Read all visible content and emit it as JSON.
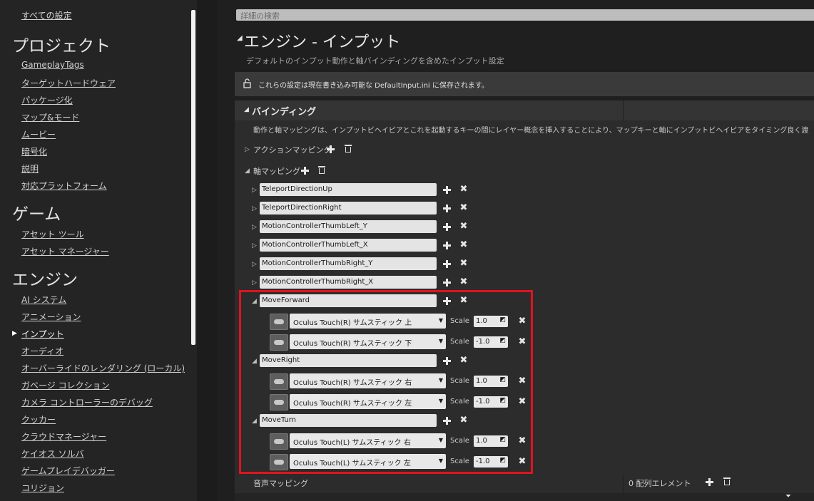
{
  "sidebar": {
    "all_settings": "すべての設定",
    "categories": [
      {
        "title": "プロジェクト",
        "items": [
          "GameplayTags",
          "ターゲットハードウェア",
          "パッケージ化",
          "マップ&モード",
          "ムービー",
          "暗号化",
          "説明",
          "対応プラットフォーム"
        ]
      },
      {
        "title": "ゲーム",
        "items": [
          "アセット ツール",
          "アセット マネージャー"
        ]
      },
      {
        "title": "エンジン",
        "items": [
          "AI システム",
          "アニメーション",
          "インプット",
          "オーディオ",
          "オーバーライドのレンダリング (ローカル)",
          "ガベージ コレクション",
          "カメラ コントローラーのデバッグ",
          "クッカー",
          "クラウドマネージャー",
          "ケイオス ソルバ",
          "ゲームプレイデバッガー",
          "コリジョン"
        ]
      }
    ],
    "active_item": "インプット"
  },
  "search": {
    "placeholder": "詳細の検索"
  },
  "header": {
    "title": "エンジン - インプット",
    "description": "デフォルトのインプット動作と軸バインディングを含めたインプット設定"
  },
  "notice": {
    "text": "これらの設定は現在書き込み可能な DefaultInput.ini に保存されます。"
  },
  "bindings": {
    "title": "バインディング",
    "description": "動作と軸マッピングは、インプットビヘイビアとこれを起動するキーの間にレイヤー概念を挿入することにより、マップキーと軸にインプットビヘイビアをタイミング良く渡",
    "action_mappings_label": "アクションマッピング",
    "axis_mappings_label": "軸マッピング",
    "scale_label": "Scale",
    "axis_mappings": [
      {
        "name": "TeleportDirectionUp",
        "expanded": false,
        "keys": []
      },
      {
        "name": "TeleportDirectionRight",
        "expanded": false,
        "keys": []
      },
      {
        "name": "MotionControllerThumbLeft_Y",
        "expanded": false,
        "keys": []
      },
      {
        "name": "MotionControllerThumbLeft_X",
        "expanded": false,
        "keys": []
      },
      {
        "name": "MotionControllerThumbRight_Y",
        "expanded": false,
        "keys": []
      },
      {
        "name": "MotionControllerThumbRight_X",
        "expanded": false,
        "keys": []
      },
      {
        "name": "MoveForward",
        "expanded": true,
        "keys": [
          {
            "key": "Oculus Touch(R) サムスティック 上",
            "scale": "1.0"
          },
          {
            "key": "Oculus Touch(R) サムスティック 下",
            "scale": "-1.0"
          }
        ]
      },
      {
        "name": "MoveRight",
        "expanded": true,
        "keys": [
          {
            "key": "Oculus Touch(R) サムスティック 右",
            "scale": "1.0"
          },
          {
            "key": "Oculus Touch(R) サムスティック 左",
            "scale": "-1.0"
          }
        ]
      },
      {
        "name": "MoveTurn",
        "expanded": true,
        "keys": [
          {
            "key": "Oculus Touch(L) サムスティック 右",
            "scale": "1.0"
          },
          {
            "key": "Oculus Touch(L) サムスティック 左",
            "scale": "-1.0"
          }
        ]
      }
    ],
    "speech_mappings_label": "音声マッピング",
    "speech_mappings_count": "0 配列エレメント"
  },
  "colors": {
    "highlight_border": "#e0141e",
    "panel_bg": "#2c2c2c"
  }
}
